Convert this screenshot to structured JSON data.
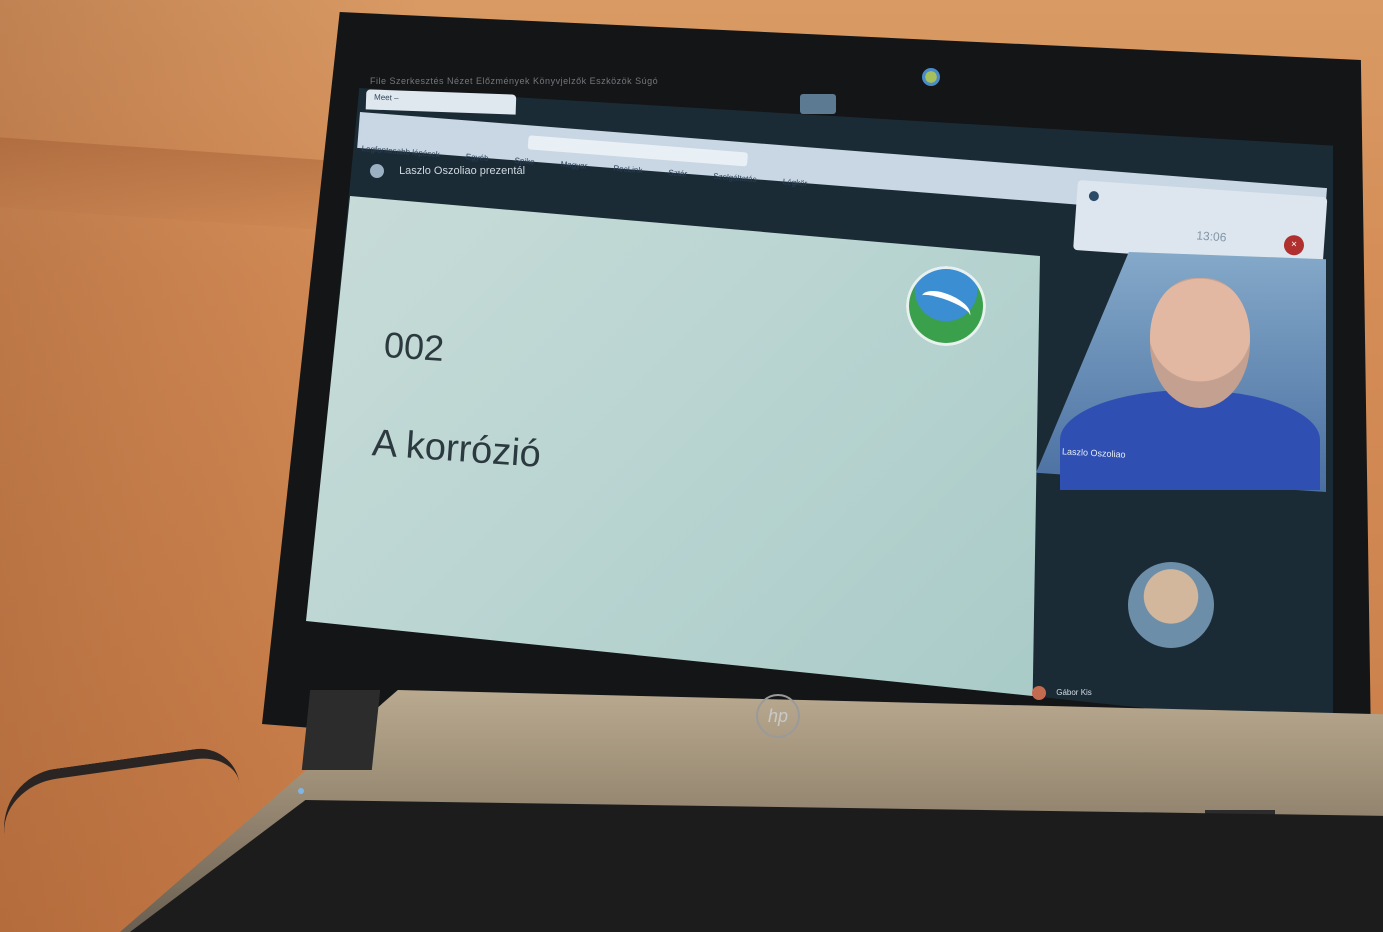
{
  "scene": {
    "description_free": true
  },
  "browser": {
    "tab_title": "Meet – ",
    "bookmarks": [
      "Legfontosabb lépések",
      "Egyéb",
      "Spike",
      "Magyar",
      "RecLink",
      "Sztár",
      "Szolgáltatás",
      "Légkör"
    ]
  },
  "meet": {
    "presenting_label": "Laszlo Oszoliao prezentál",
    "main_participant": "Laszlo Oszoliao",
    "second_participant": "Gábor Kis",
    "notification_time": "13:06"
  },
  "slide": {
    "number": "002",
    "title": "A korrózió"
  },
  "laptop": {
    "brand": "hp"
  }
}
